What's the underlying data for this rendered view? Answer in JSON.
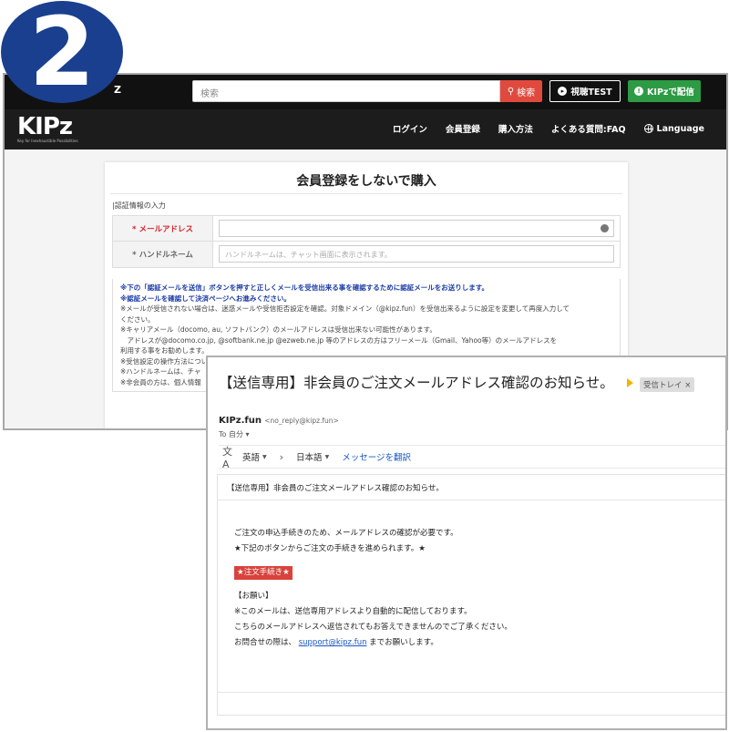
{
  "step_number": "2",
  "site": {
    "topbar": {
      "brand_small": "Z",
      "search_placeholder": "検索",
      "search_button": "検索",
      "watch_test": "視聴TEST",
      "stream": "KIPzで配信"
    },
    "logo": {
      "mark": "KIPz",
      "tagline": "Key for Inexhaustible Possibilities"
    },
    "nav": [
      "ログイン",
      "会員登録",
      "購入方法",
      "よくある質問:FAQ",
      "Language"
    ],
    "form": {
      "title": "会員登録をしないで購入",
      "section_label": "|認証情報の入力",
      "email_label": "* メールアドレス",
      "handle_label": "* ハンドルネーム",
      "handle_placeholder": "ハンドルネームは、チャット画面に表示されます。",
      "notice_lines": [
        "※下の「認証メールを送信」ボタンを押すと正しくメールを受信出来る事を確認するために認証メールをお送りします。",
        "※認証メールを確認して決済ページへお進みください。",
        "※メールが受信されない場合は、迷惑メールや受信拒否設定を確認。対象ドメイン（@kipz.fun）を受信出来るように設定を変更して再度入力して",
        "ください。",
        "※キャリアメール（docomo, au, ソフトバンク）のメールアドレスは受信出来ない可能性があります。",
        "　アドレスが@docomo.co.jp, @softbank.ne.jp @ezweb.ne.jp 等のアドレスの方はフリーメール（Gmail、Yahoo等）のメールアドレスを",
        "利用する事をお勧めします。",
        "※受信設定の操作方法について",
        "※ハンドルネームは、チャ",
        "※非会員の方は、個人情報"
      ]
    }
  },
  "mail": {
    "subject": "【送信専用】非会員のご注文メールアドレス確認のお知らせ。",
    "inbox_chip": "受信トレイ ×",
    "sender_name": "KIPz.fun",
    "sender_addr": "<no_reply@kipz.fun>",
    "to": "To 自分 ▾",
    "translate": {
      "from": "英語",
      "to": "日本語",
      "link": "メッセージを翻訳"
    },
    "body_header": "【送信専用】非会員のご注文メールアドレス確認のお知らせ。",
    "body_lines": [
      "ご注文の申込手続きのため、メールアドレスの確認が必要です。",
      "★下記のボタンからご注文の手続きを進められます。★"
    ],
    "order_button": "★注文手続き★",
    "request_heading": "【お願い】",
    "request_lines": [
      "※このメールは、送信専用アドレスより自動的に配信しております。",
      "こちらのメールアドレスへ返信されてもお答えできませんのでご了承ください。"
    ],
    "contact_prefix": "お問合せの際は、",
    "contact_link": "support@kipz.fun",
    "contact_suffix": " までお願いします。"
  }
}
